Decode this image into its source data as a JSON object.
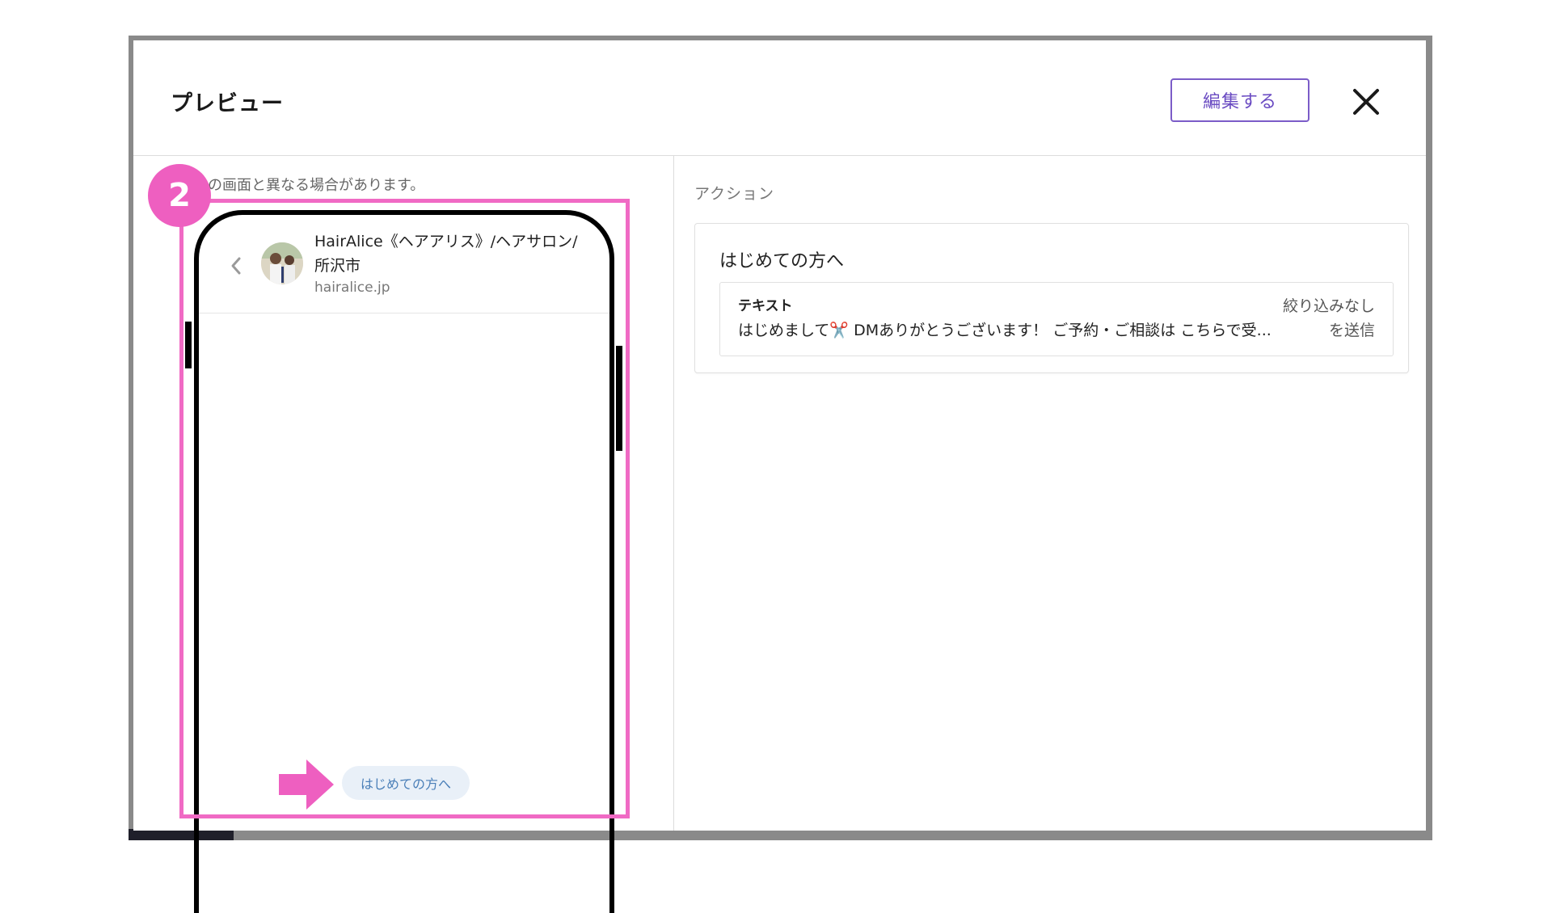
{
  "modal": {
    "title": "プレビュー",
    "edit_label": "編集する"
  },
  "preview": {
    "note": "の画面と異なる場合があります。",
    "step_number": "2",
    "account_name": "HairAlice《ヘアアリス》/ヘアサロン/所沢市",
    "account_url": "hairalice.jp",
    "quick_reply": "はじめての方へ"
  },
  "actions": {
    "label": "アクション",
    "card_title": "はじめての方へ",
    "item": {
      "type": "テキスト",
      "filter": "絞り込みなし",
      "message": "はじめまして✂️ DMありがとうございます！ ご予約・ご相談は こちらで受...",
      "send_label": "を送信"
    }
  },
  "colors": {
    "accent_purple": "#6a4bc2",
    "highlight_pink": "#f06ac4",
    "quick_reply_bg": "#e9f0f8",
    "quick_reply_text": "#4a7fb8"
  },
  "icons": {
    "close": "close-icon",
    "back": "chevron-left-icon",
    "arrow": "arrow-right-icon"
  }
}
